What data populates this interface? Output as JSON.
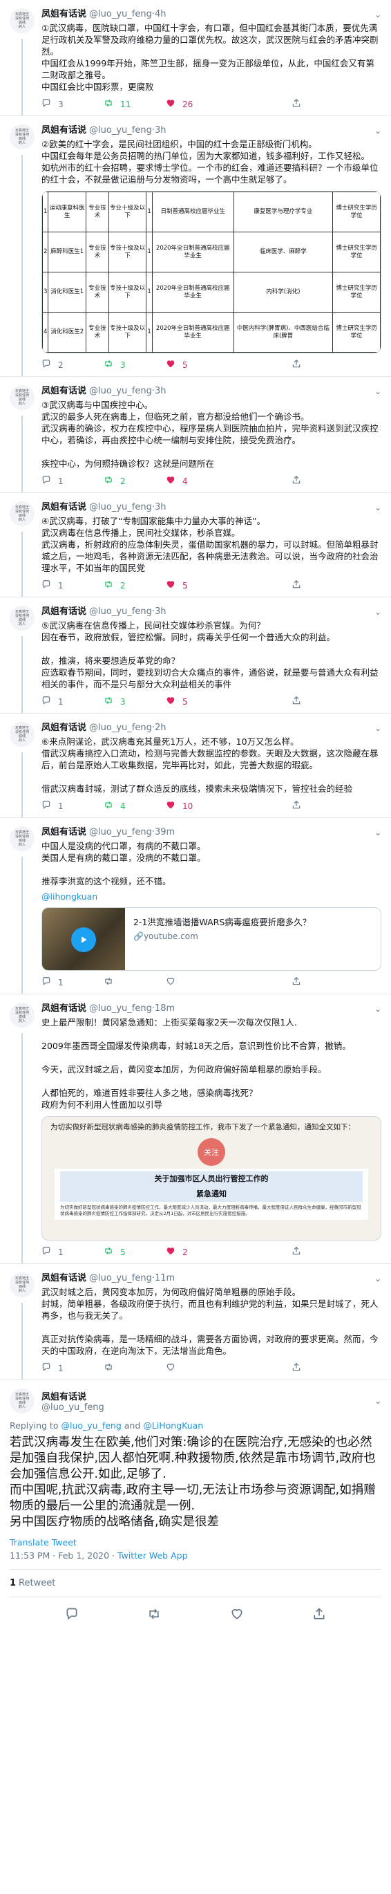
{
  "user": {
    "name": "凤姐有话说",
    "handle": "@luo_yu_feng",
    "avatar_text": [
      "天真地王",
      "没有任何",
      "底线",
      "的人"
    ]
  },
  "tweets": [
    {
      "time": "4h",
      "text": "①武汉病毒，医院缺口罩，中国红十字会，有口罩，但中国红会基其街门本质，要优先满足行政机关及军警及政府维稳力量的口罩优先权。故这次，武汉医院与红会的矛盾冲突剧烈。\n中国红会从1999年开始，陈竺卫生部，摇身一变为正部级单位，从此，中国红会又有第二财政部之雅号。\n中国红会比中国彩票，更腐败",
      "replies": "3",
      "retweets": "11",
      "likes": "26"
    },
    {
      "time": "3h",
      "text": "②欧美的红十字会，是民间社团组织，中国的红十会是正部级街门机构。\n中国红会每年是公务员招聘的热门单位，因为大家都知道，钱多福利好，工作又轻松。\n如杭州市的红十会招聘，要求博士学位。一个市的红会，难道还要搞科研？一个市级单位的红十会，不就是做记追册与分发物资吗，一个高中生就足够了。",
      "replies": "2",
      "retweets": "3",
      "likes": "5",
      "table": [
        [
          "1",
          "运动康复科医生",
          "专业技术",
          "专业十级及以下",
          "1",
          "日制普通高校应届毕业生",
          "康复医学与理疗学专业",
          "博士研究生学历学位"
        ],
        [
          "2",
          "麻醉科医生1",
          "专业技术",
          "专技十级及以下",
          "1",
          "2020年全日制普通高校应届毕业生",
          "临床医学、麻醉学",
          "博士研究生学历学位"
        ],
        [
          "3",
          "消化科医生1",
          "专业技术",
          "专技十级及以下",
          "1",
          "2020年全日制普通高校应届毕业生",
          "内科学(消化)",
          "博士研究生学历学位"
        ],
        [
          "4",
          "消化科医生2",
          "专业技术",
          "专技十级及以下",
          "1",
          "2020年全日制普通高校应届毕业生",
          "中医内科学(脾胃病)、中西医结合临床(脾胃",
          "博士研究生学历学位"
        ]
      ]
    },
    {
      "time": "3h",
      "text": "③武汉病毒与中国疾控中心。\n武汉的最多人死在病毒上，但临死之前，官方都没给他们一个确诊书。\n武汉病毒的确诊，权力在疾控中心，程序是病人到医院抽血拍片，完毕资料送到武汉疾控中心，若确诊，再由疾控中心统一编制与安排住院，接受免费治疗。\n\n疾控中心，为何照持确诊权？这就是问题所在",
      "replies": "1",
      "retweets": "2",
      "likes": "4"
    },
    {
      "time": "3h",
      "text": "④武汉病毒，打破了“专制国家能集中力量办大事的神话”。\n武汉病毒在信息传播上，民间社交媒体，秒杀官媒。\n武汉病毒，折射政府的应急体制失灵，蛋借助国家机器的暴力，可以封城。但简单粗暴封城之后，一地鸡毛，各种资源无法匹配，各种病患无法救治。可以说，当今政府的社会治理水平，不如当年的国民党",
      "replies": "1",
      "retweets": "2",
      "likes": "5"
    },
    {
      "time": "3h",
      "text": "⑤武汉病毒在信息传播上，民间社交媒体秒杀官媒。为何？\n因在春节，政府放假，管控松懈。同时，病毒关乎任何一个普通大众的利益。\n\n故，推演，将来要想造反革党的命？\n应选取春节期间，同时，要找到切合大众痛点的事件，通俗说，就是要与普通大众有利益相关的事件，而不是只与部分大众利益相关的事件",
      "replies": "1",
      "retweets": "3",
      "likes": "5"
    },
    {
      "time": "2h",
      "text": "⑥来点阴谋论，武汉病毒充其量死1万人，还不够，10万又怎么样。\n借武汉病毒搞控入口流动，检测与完善大数据监控的参数。天眼及大数据，这次隐藏在暴后，前台是原始人工收集数据，完毕再比对，如此，完善大数据的瑕疵。\n\n借武汉病毒封城，测试了群众造反的底线，摸索未来极端情况下，管控社会的经验",
      "replies": "1",
      "retweets": "4",
      "likes": "10"
    },
    {
      "time": "39m",
      "text": "中国人是没病的代口罩，有病的不戴口罩。\n美国人是有病的戴口罩，没病的不戴口罩。\n\n推荐李洪宽的这个视频，还不错。",
      "mention": "@lihongkuan",
      "card_title": "2-1洪宽推墙谐播WARS病毒瘟疫要折磨多久？",
      "card_domain": "youtube.com",
      "replies": "1",
      "retweets": "",
      "likes": ""
    },
    {
      "time": "18m",
      "text": "史上最严限制！黄冈紧急通知：上街买菜每家2天一次每次仅限1人.\n\n2009年墨西哥全国爆发传染病毒，封城18天之后，意识到性价比不合算，撤销。\n\n今天，武汉封城之后，黄冈变本加厉，为何政府偏好简单粗暴的原始手段。\n\n人都怕死的，难道百姓非要往人多之地，感染病毒找死？\n政府为何不利用人性面加以引导",
      "notice_top": "为切实做好新型冠状病毒感染的肺炎疫情防控工作，我市下发了一个紧急通知，通知全文如下：",
      "notice_badge": "关注",
      "notice_title": "关于加强市区人员出行管控工作的",
      "notice_title2": "紧急通知",
      "notice_body": "为切实做好新型冠状病毒感染的肺炎疫情防控工作，最大限度减少人员流动，最大力度阻断病毒传播，最大程度保证人民群众生命健康，经黄冈市新型冠状病毒感染的肺炎疫情防控工作指挥部研究，决定从2月1日起，对市区居民出行实施管控措施。",
      "replies": "1",
      "retweets": "5",
      "likes": "2"
    },
    {
      "time": "11m",
      "text": "武汉封城之后，黄冈变本加厉，为何政府偏好简单粗暴的原始手段。\n封城，简单粗暴，各级政府便于执行，而且也有利维护党的利益，如果只是封城了，死人再多，也与我无关了。\n\n真正对抗传染病毒，是一场精细的战斗，需要各方面协调，对政府的要求更高。然而，今天的中国政府，在逆向淘汰下，无法增当此角色。",
      "replies": "1",
      "retweets": "",
      "likes": ""
    }
  ],
  "main": {
    "replying_prefix": "Replying to",
    "replying_1": "@luo_yu_feng",
    "replying_and": "and",
    "replying_2": "@LiHongKuan",
    "text": "若武汉病毒发生在欧美,他们对策:确诊的在医院治疗,无感染的也必然是加强自我保护,因人都怕死啊.种救援物质,依然是靠市场调节,政府也会加强信息公开.如此,足够了.\n而中国呢,抗武汉病毒,政府主导一切,无法让市场参与资源调配,如捐赠物质的最后一公里的流通就是一例.\n另中国医疗物质的战略储备,确实是很差",
    "translate": "Translate Tweet",
    "timestamp": "11:53 PM · Feb 1, 2020",
    "via": "Twitter Web App",
    "retweet_count": "1",
    "retweet_label": "Retweet"
  }
}
